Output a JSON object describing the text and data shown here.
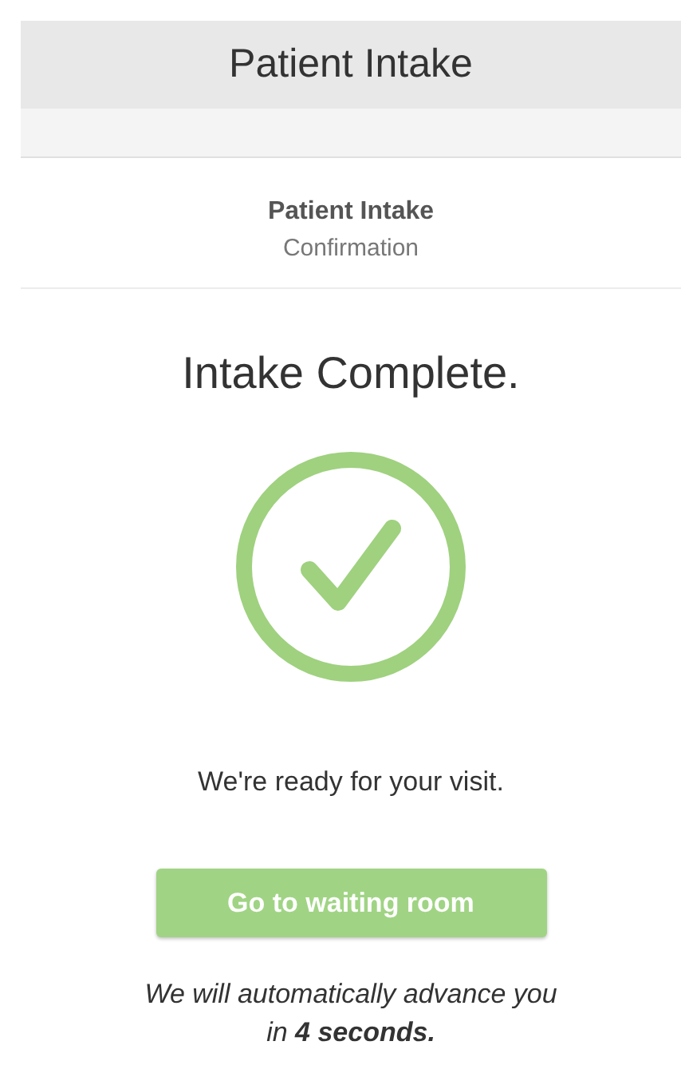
{
  "header": {
    "title": "Patient Intake"
  },
  "subheader": {
    "title": "Patient Intake",
    "subtitle": "Confirmation"
  },
  "heading": "Intake Complete.",
  "message": "We're ready for your visit.",
  "button": {
    "label": "Go to waiting room"
  },
  "note": "We will automatically advance you in **4 seconds.**"
}
